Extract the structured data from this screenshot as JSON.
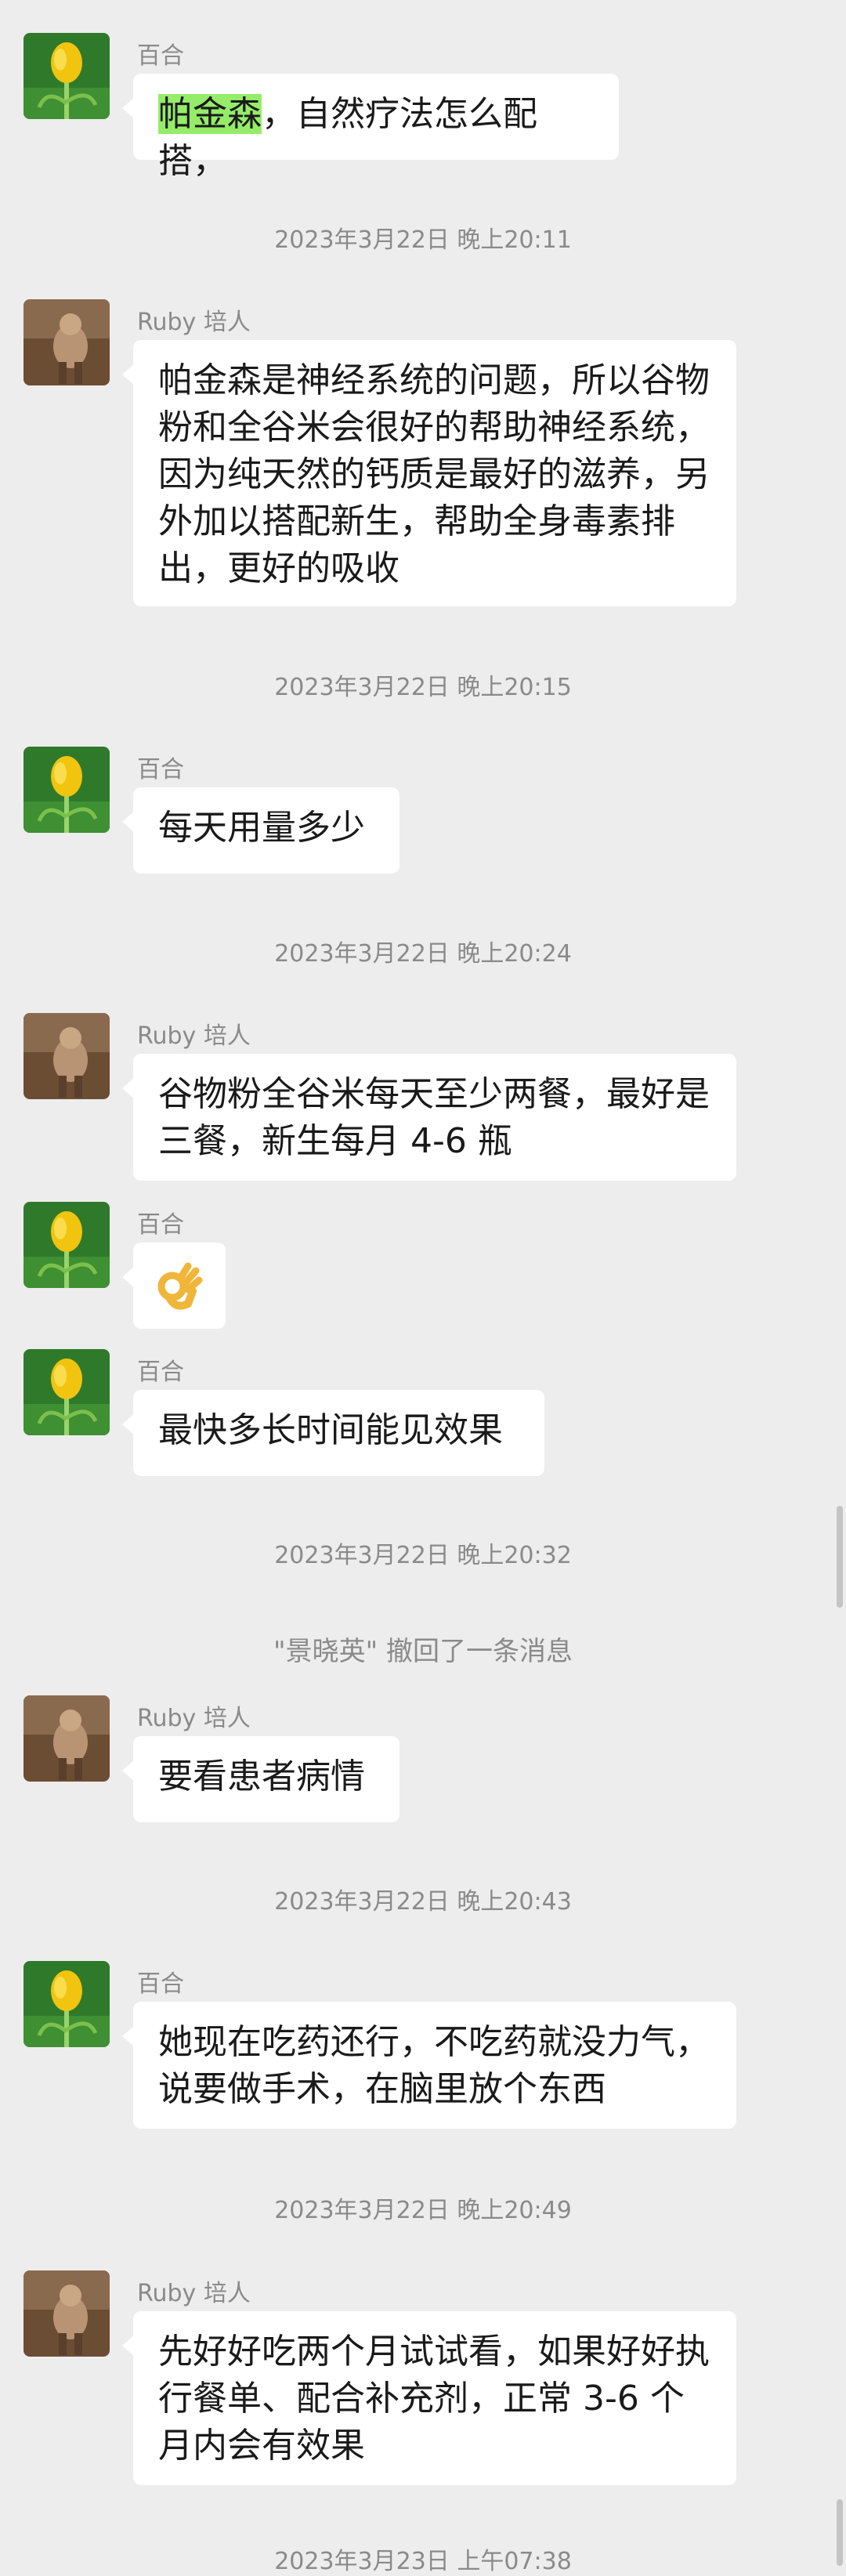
{
  "chat": {
    "items": [
      {
        "type": "message",
        "sender": "百合",
        "highlight": "帕金森",
        "text": "，自然疗法怎么配搭，"
      },
      {
        "type": "time",
        "text": "2023年3月22日 晚上20:11"
      },
      {
        "type": "message",
        "sender": "Ruby 培人",
        "text": "帕金森是神经系统的问题，所以谷物粉和全谷米会很好的帮助神经系统，因为纯天然的钙质是最好的滋养，另外加以搭配新生，帮助全身毒素排出，更好的吸收"
      },
      {
        "type": "time",
        "text": "2023年3月22日 晚上20:15"
      },
      {
        "type": "message",
        "sender": "百合",
        "text": "每天用量多少"
      },
      {
        "type": "time",
        "text": "2023年3月22日 晚上20:24"
      },
      {
        "type": "message",
        "sender": "Ruby 培人",
        "text": "谷物粉全谷米每天至少两餐，最好是三餐，新生每月 4-6 瓶"
      },
      {
        "type": "message",
        "sender": "百合",
        "emoji": "ok-hand-emoji"
      },
      {
        "type": "message",
        "sender": "百合",
        "text": "最快多长时间能见效果"
      },
      {
        "type": "time",
        "text": "2023年3月22日 晚上20:32"
      },
      {
        "type": "system",
        "text": "\"景晓英\" 撤回了一条消息"
      },
      {
        "type": "message",
        "sender": "Ruby 培人",
        "text": "要看患者病情"
      },
      {
        "type": "time",
        "text": "2023年3月22日 晚上20:43"
      },
      {
        "type": "message",
        "sender": "百合",
        "text": "她现在吃药还行，不吃药就没力气，说要做手术，在脑里放个东西"
      },
      {
        "type": "time",
        "text": "2023年3月22日 晚上20:49"
      },
      {
        "type": "message",
        "sender": "Ruby 培人",
        "text": "先好好吃两个月试试看，如果好好执行餐单、配合补充剂，正常 3-6 个月内会有效果"
      },
      {
        "type": "time",
        "text": "2023年3月23日 上午07:38"
      }
    ]
  },
  "colors": {
    "background": "#ededed",
    "bubble": "#ffffff",
    "highlight": "#95ec69",
    "meta_text": "#8a8a8a"
  }
}
